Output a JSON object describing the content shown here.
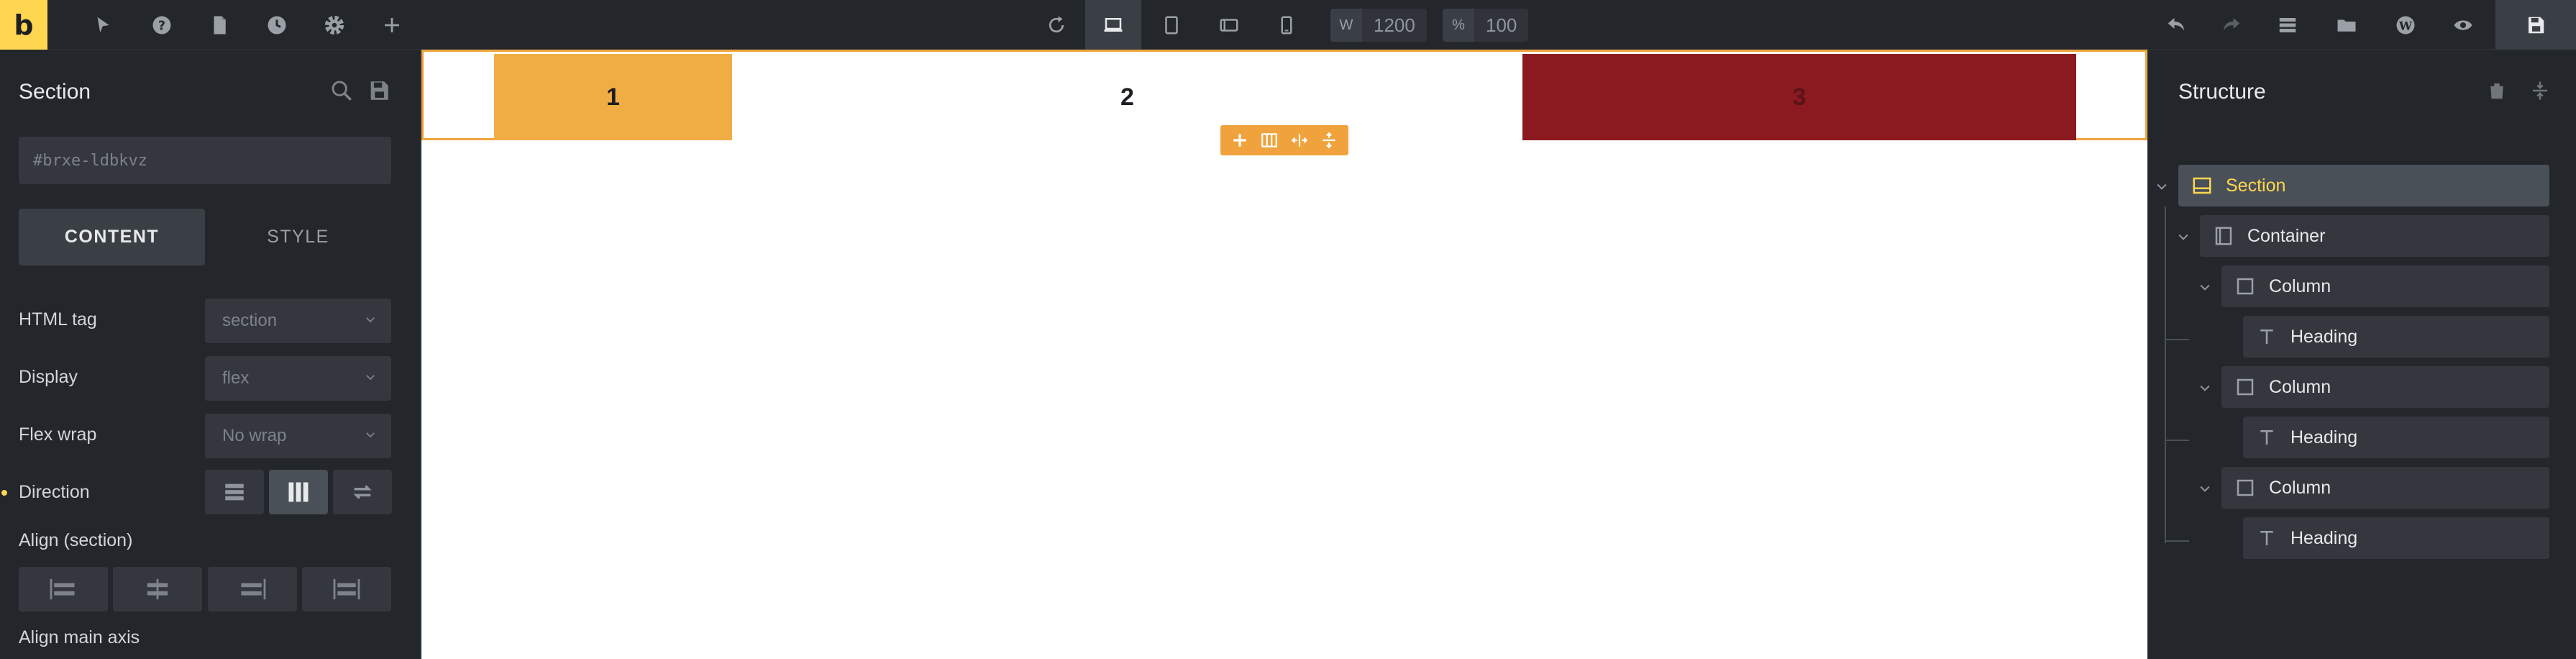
{
  "app": {
    "logo_letter": "b"
  },
  "toolbar": {
    "icons": [
      "cursor-icon",
      "help-icon",
      "page-icon",
      "history-icon",
      "settings-icon",
      "add-icon"
    ],
    "reload_icon": "reload-icon",
    "breakpoints": [
      "desktop",
      "tablet-portrait",
      "tablet-landscape",
      "mobile"
    ],
    "width_label": "W",
    "width_value": "1200",
    "zoom_label": "%",
    "zoom_value": "100",
    "right_icons": [
      "undo-icon",
      "redo-icon",
      "layers-icon",
      "folder-icon",
      "wordpress-icon",
      "preview-icon"
    ],
    "save_icon": "save-icon"
  },
  "left_panel": {
    "title": "Section",
    "element_id": "#brxe-ldbkvz",
    "tabs": {
      "content": "CONTENT",
      "style": "STYLE"
    },
    "controls": {
      "html_tag": {
        "label": "HTML tag",
        "value": "section"
      },
      "display": {
        "label": "Display",
        "value": "flex"
      },
      "flex_wrap": {
        "label": "Flex wrap",
        "value": "No wrap"
      },
      "direction": {
        "label": "Direction"
      },
      "align_section": {
        "label": "Align (section)"
      },
      "align_main_axis": {
        "label": "Align main axis"
      }
    }
  },
  "canvas": {
    "columns": [
      {
        "label": "1",
        "color": "#f0ad44"
      },
      {
        "label": "2",
        "color": "#ffffff"
      },
      {
        "label": "3",
        "color": "#8b1a20"
      }
    ],
    "accent": "#f0a33c"
  },
  "structure": {
    "title": "Structure",
    "items": [
      {
        "label": "Section",
        "icon": "section-icon"
      },
      {
        "label": "Container",
        "icon": "container-icon"
      },
      {
        "label": "Column",
        "icon": "column-icon"
      },
      {
        "label": "Heading",
        "icon": "heading-icon"
      },
      {
        "label": "Column",
        "icon": "column-icon"
      },
      {
        "label": "Heading",
        "icon": "heading-icon"
      },
      {
        "label": "Column",
        "icon": "column-icon"
      },
      {
        "label": "Heading",
        "icon": "heading-icon"
      }
    ]
  }
}
